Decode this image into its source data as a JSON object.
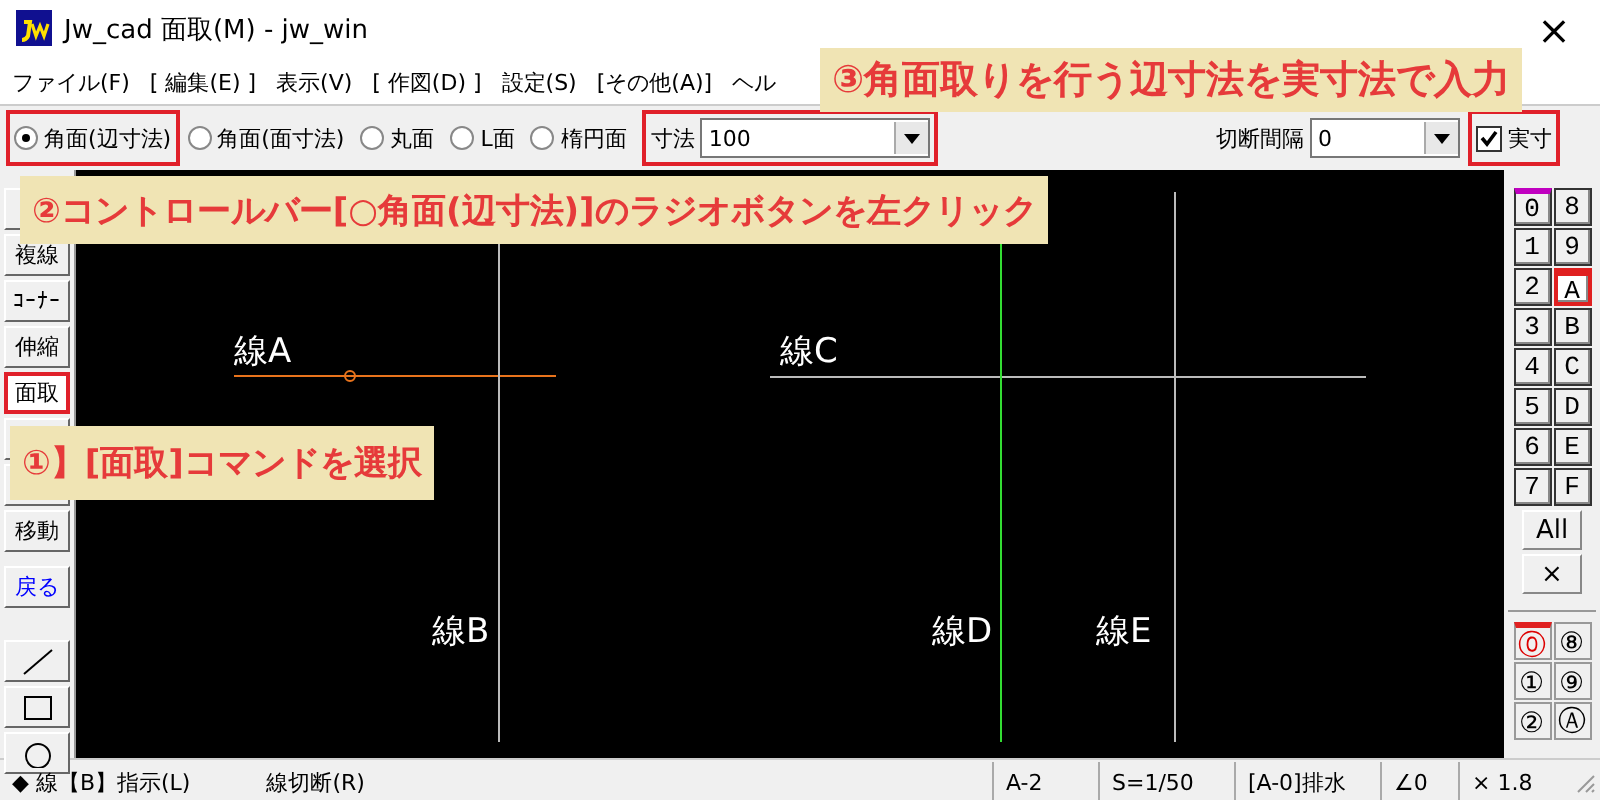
{
  "window": {
    "title": "Jw_cad 面取(M) - jw_win",
    "close": "×"
  },
  "menu": [
    "ファイル(F)",
    "[ 編集(E) ]",
    "表示(V)",
    "[ 作図(D) ]",
    "設定(S)",
    "[その他(A)]",
    "ヘル"
  ],
  "control_bar": {
    "radios": [
      {
        "label": "角面(辺寸法)",
        "selected": true,
        "highlighted": true
      },
      {
        "label": "角面(面寸法)",
        "selected": false,
        "highlighted": false
      },
      {
        "label": "丸面",
        "selected": false,
        "highlighted": false
      },
      {
        "label": "L面",
        "selected": false,
        "highlighted": false
      },
      {
        "label": "楕円面",
        "selected": false,
        "highlighted": false
      }
    ],
    "fields": [
      {
        "label": "寸法",
        "value": "100",
        "highlighted": true
      },
      {
        "label": "切断間隔",
        "value": "0",
        "highlighted": false
      }
    ],
    "checkbox": {
      "label": "実寸",
      "checked": true,
      "highlighted": true
    }
  },
  "left_toolbar": [
    {
      "kind": "blank",
      "highlighted": false
    },
    {
      "kind": "text",
      "label": "複線",
      "highlighted": false
    },
    {
      "kind": "text",
      "label": "ｺｰﾅｰ",
      "highlighted": false
    },
    {
      "kind": "text",
      "label": "伸縮",
      "highlighted": false
    },
    {
      "kind": "text",
      "label": "面取",
      "highlighted": true
    },
    {
      "kind": "blank",
      "highlighted": false
    },
    {
      "kind": "blank",
      "highlighted": false
    },
    {
      "kind": "text",
      "label": "移動",
      "highlighted": false
    },
    {
      "kind": "text",
      "label": "戻る",
      "color": "#0000ff",
      "highlighted": false
    },
    {
      "kind": "line",
      "highlighted": false
    },
    {
      "kind": "rect",
      "highlighted": false
    },
    {
      "kind": "circle",
      "highlighted": false
    }
  ],
  "canvas": {
    "labels": [
      "線A",
      "線B",
      "線C",
      "線D",
      "線E"
    ]
  },
  "layers": [
    {
      "label": "0",
      "selected": false,
      "active": true
    },
    {
      "label": "8",
      "selected": false,
      "active": false
    },
    {
      "label": "1",
      "selected": false,
      "active": false
    },
    {
      "label": "9",
      "selected": false,
      "active": false
    },
    {
      "label": "2",
      "selected": false,
      "active": false
    },
    {
      "label": "A",
      "selected": true,
      "active": false
    },
    {
      "label": "3",
      "selected": false,
      "active": false
    },
    {
      "label": "B",
      "selected": false,
      "active": false
    },
    {
      "label": "4",
      "selected": false,
      "active": false
    },
    {
      "label": "C",
      "selected": false,
      "active": false
    },
    {
      "label": "5",
      "selected": false,
      "active": false
    },
    {
      "label": "D",
      "selected": false,
      "active": false
    },
    {
      "label": "6",
      "selected": false,
      "active": false
    },
    {
      "label": "E",
      "selected": false,
      "active": false
    },
    {
      "label": "7",
      "selected": false,
      "active": false
    },
    {
      "label": "F",
      "selected": false,
      "active": false
    }
  ],
  "layer_buttons": [
    "All",
    "×"
  ],
  "layer_groups": [
    {
      "label": "⓪",
      "selected": true
    },
    {
      "label": "⑧",
      "selected": false
    },
    {
      "label": "①",
      "selected": false
    },
    {
      "label": "⑨",
      "selected": false
    },
    {
      "label": "②",
      "selected": false
    },
    {
      "label": "Ⓐ",
      "selected": false
    }
  ],
  "status_bar": {
    "message": "◆ 線【B】指示(L)",
    "right_click": "線切断(R)",
    "cells": [
      "A-2",
      "S=1/50",
      "[A-0]排水",
      "∠0",
      "× 1.8"
    ]
  },
  "callouts": [
    "③角面取りを行う辺寸法を実寸法で入力",
    "②コントロールバー[○角面(辺寸法)]のラジオボタンを左クリック",
    "①】[面取]コマンドを選択"
  ]
}
